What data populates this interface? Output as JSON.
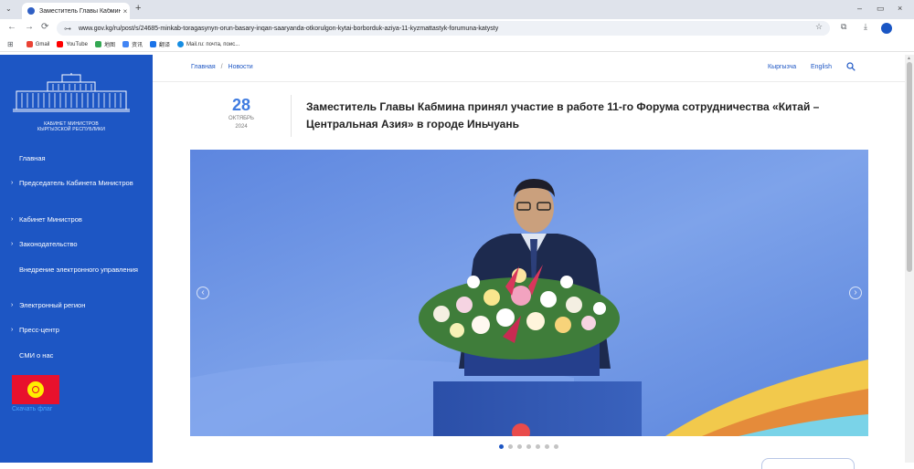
{
  "browser": {
    "tab_title": "Заместитель Главы Кабмина п",
    "tab_close": "×",
    "new_tab": "+",
    "menu_icon": "chevron-down-icon",
    "window_controls": [
      "–",
      "▭",
      "×"
    ],
    "nav": {
      "back": "←",
      "forward": "→",
      "reload": "⟳"
    },
    "url": "www.gov.kg/ru/post/s/24685-minkab-toragasynyn-orun-basary-inqan-saaryanda-otkorulgon-kytai-borborduk-aziya-11-kyzmattastyk-forumuna-katysty",
    "tune_icon": "⊶",
    "star_icon": "☆",
    "ext_icons": [
      "⧉",
      "⤓"
    ],
    "bookmarks": [
      {
        "label": "Gmail",
        "color": "#ea4335"
      },
      {
        "label": "YouTube",
        "color": "#ff0000"
      },
      {
        "label": "地图",
        "color": "#34a853"
      },
      {
        "label": "资讯",
        "color": "#4285f4"
      },
      {
        "label": "翻译",
        "color": "#1a73e8"
      },
      {
        "label": "Mail.ru: почта, поис...",
        "color": "#168de2"
      }
    ]
  },
  "sidebar": {
    "logo_line1": "КАБИНЕТ МИНИСТРОВ",
    "logo_line2": "КЫРГЫЗСКОЙ РЕСПУБЛИКИ",
    "items": [
      {
        "label": "Главная",
        "arrow": ""
      },
      {
        "label": "Председатель Кабинета Министров",
        "arrow": "›"
      },
      {
        "label": "Кабинет Министров",
        "arrow": "›"
      },
      {
        "label": "Законодательство",
        "arrow": "›"
      },
      {
        "label": "Внедрение электронного управления",
        "arrow": ""
      },
      {
        "label": "Электронный регион",
        "arrow": "›"
      },
      {
        "label": "Пресс-центр",
        "arrow": "›"
      },
      {
        "label": "СМИ о нас",
        "arrow": ""
      }
    ],
    "download_flag": "Скачать флаг"
  },
  "header": {
    "breadcrumb": [
      "Главная",
      "Новости"
    ],
    "breadcrumb_sep": "/",
    "lang_ky": "Кыргызча",
    "lang_en": "English"
  },
  "article": {
    "day": "28",
    "month": "ОКТЯБРЬ",
    "year": "2024",
    "title": "Заместитель Главы Кабмина принял участие в работе 11-го Форума сотрудничества «Китай – Центральная Азия» в городе Иньчуань",
    "slider": {
      "prev": "‹",
      "next": "›",
      "count": 7,
      "active": 0
    }
  },
  "colors": {
    "brand": "#1d56c4",
    "accent": "#3f7be0"
  }
}
